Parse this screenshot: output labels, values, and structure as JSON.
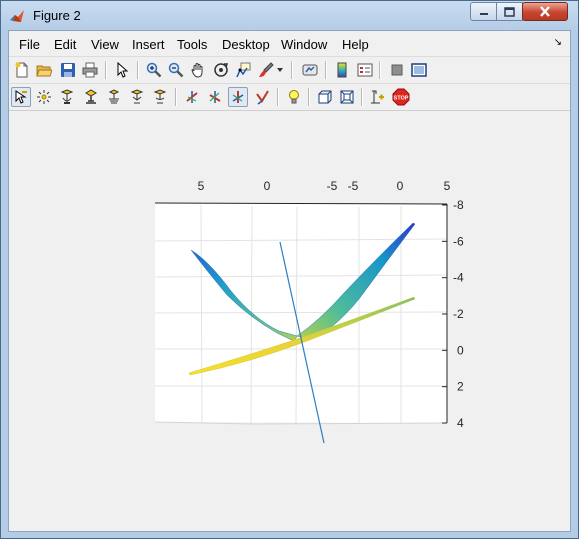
{
  "window": {
    "title": "Figure 2"
  },
  "menubar": {
    "items": [
      "File",
      "Edit",
      "View",
      "Insert",
      "Tools",
      "Desktop",
      "Window",
      "Help"
    ],
    "dock_arrow": "↘"
  },
  "toolbar1": {
    "icons": [
      "new-figure-icon",
      "open-file-icon",
      "save-figure-icon",
      "print-figure-icon",
      "edit-plot-icon",
      "zoom-in-icon",
      "zoom-out-icon",
      "pan-icon",
      "rotate-3d-icon",
      "data-cursor-icon",
      "brush-icon",
      "brush-dropdown-icon",
      "link-plot-icon",
      "insert-colorbar-icon",
      "insert-legend-icon",
      "hide-plot-tools-icon",
      "show-plot-tools-icon"
    ]
  },
  "toolbar2": {
    "icons": [
      "select-camera-icon",
      "orbit-light-icon",
      "orbit-camera-icon",
      "pan-tilt-icon",
      "move-camera-icon",
      "zoom-camera-icon",
      "roll-camera-icon",
      "x-principal-axis-icon",
      "y-principal-axis-icon",
      "z-principal-axis-icon",
      "no-principal-axis-icon",
      "toggle-scene-light-icon",
      "orthographic-projection-icon",
      "perspective-projection-icon",
      "reset-camera-icon",
      "stop-camera-icon"
    ],
    "stop_label": "STOP"
  },
  "chart_data": {
    "type": "surface3d",
    "top_axis_ticks": [
      "5",
      "0",
      "-5",
      "-5",
      "0",
      "5"
    ],
    "right_axis_ticks": [
      "-8",
      "-6",
      "-4",
      "-2",
      "0",
      "2",
      "4"
    ],
    "right_axis_range": [
      -8,
      4
    ],
    "grid": true,
    "colormap": "parula",
    "colors": {
      "surface_low": "#f5e02a",
      "surface_mid": "#7fc96a",
      "surface_high_a": "#1aa3c6",
      "surface_high_b": "#2a3ec6",
      "line": "#2b7fc1",
      "axis": "#262626",
      "grid": "#e0e0e0"
    }
  }
}
